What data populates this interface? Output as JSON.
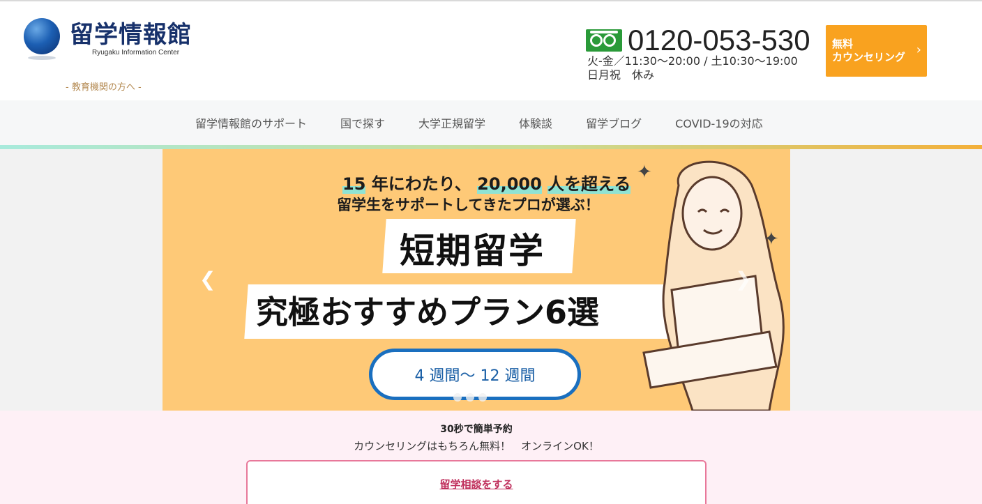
{
  "header": {
    "logo_title": "留学情報館",
    "logo_subtitle": "Ryugaku Information Center",
    "edu_link": "- 教育機関の方へ -",
    "phone_number": "0120-053-530",
    "hours_line1": "火-金／11:30〜20:00 / 土10:30〜19:00",
    "hours_line2": "日月祝　休み",
    "counsel_button_line1": "無料",
    "counsel_button_line2": "カウンセリング"
  },
  "nav": {
    "items": [
      {
        "label": "留学情報館のサポート"
      },
      {
        "label": "国で探す"
      },
      {
        "label": "大学正規留学"
      },
      {
        "label": "体験談"
      },
      {
        "label": "留学ブログ"
      },
      {
        "label": "COVID-19の対応"
      }
    ]
  },
  "banner": {
    "line1_num1": "15",
    "line1_mid": "年にわたり、",
    "line1_num2": "20,000",
    "line1_end": "人を超える",
    "line2": "留学生をサポートしてきたプロが選ぶ！",
    "title1": "短期留学",
    "title2": "究極おすすめプラン6選",
    "pill": "4 週間〜 12 週間"
  },
  "reserve": {
    "title": "30秒で簡単予約",
    "subtitle": "カウンセリングはもちろん無料！　オンラインOK！",
    "link": "留学相談をする"
  },
  "colors": {
    "accent_orange": "#f9a21f",
    "banner_bg": "#fec977",
    "freedial_green": "#2a9a39",
    "reserve_pink": "#c0305d"
  }
}
